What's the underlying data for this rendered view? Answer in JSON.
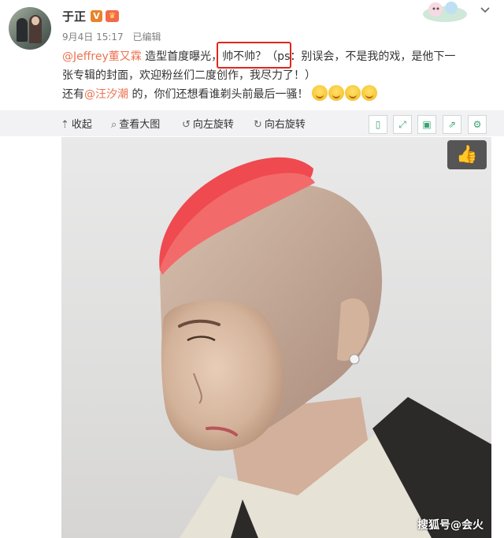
{
  "user": {
    "name": "于正",
    "badge_v": "V",
    "date": "9月4日 15:17",
    "edited": "已编辑"
  },
  "post": {
    "mention1": "@Jeffrey董又霖",
    "line1_a": " 造型首度曝光，",
    "line1_highlight": "帅不帅？",
    "line1_b": "（ps：别误会，不是我的戏，是他下一",
    "line2": "张专辑的封面，欢迎粉丝们二度创作，我尽力了！）",
    "line3_a": "还有",
    "mention2": "@汪汐潮",
    "line3_b": " 的，你们还想看谁剃头前最后一骚！"
  },
  "toolbar": {
    "collapse": "收起",
    "view_large": "查看大图",
    "rotate_left": "向左旋转",
    "rotate_right": "向右旋转"
  },
  "watermark": "搜狐号@会火",
  "colors": {
    "mention": "#eb7350",
    "highlight_box": "#e0261c",
    "hair": "#ef4a4f",
    "toolbar_icon": "#3aa474"
  },
  "icons": [
    "arrow-up-icon",
    "search-icon",
    "rotate-left-icon",
    "rotate-right-icon",
    "phone-icon",
    "expand-icon",
    "save-icon",
    "share-icon",
    "settings-icon",
    "thumbs-up-icon",
    "chevron-down-icon"
  ]
}
